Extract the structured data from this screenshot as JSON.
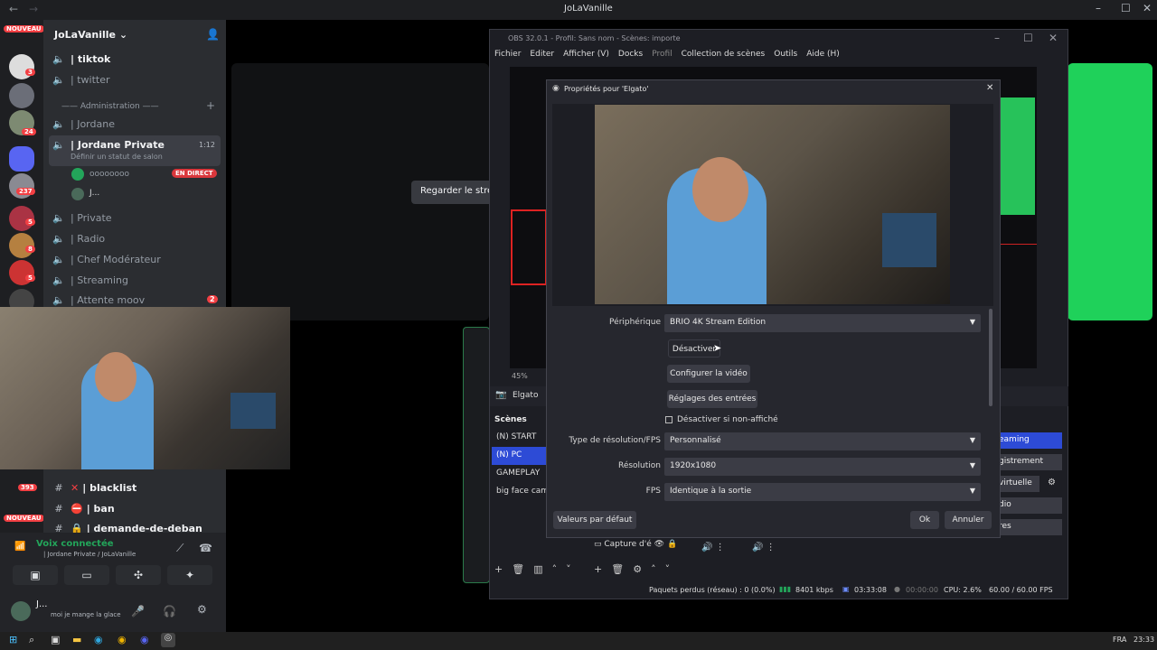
{
  "discord": {
    "window_title": "JoLaVanille",
    "server_name": "JoLaVanille",
    "guild_badges": [
      "NOUVEAU",
      "3",
      "24",
      "237",
      "5",
      "8",
      "5",
      "3",
      "393",
      "NOUVEAU"
    ],
    "channels": [
      {
        "icon": "speaker-icon",
        "name": "| tiktok",
        "bold": true
      },
      {
        "icon": "speaker-icon",
        "name": "| twitter",
        "bold": false
      },
      {
        "icon": "speaker-icon",
        "name": "| Jordane",
        "bold": false
      },
      {
        "icon": "speaker-icon",
        "name": "| Jordane Private",
        "bold": true,
        "time": "1:12"
      },
      {
        "icon": "speaker-icon",
        "name": "| Private",
        "bold": false
      },
      {
        "icon": "speaker-icon",
        "name": "| Radio",
        "bold": false
      },
      {
        "icon": "speaker-icon",
        "name": "| Chef Modérateur",
        "bold": false
      },
      {
        "icon": "speaker-icon",
        "name": "| Streaming",
        "bold": false
      },
      {
        "icon": "speaker-icon",
        "name": "| Attente moov",
        "bold": false,
        "badge": "2"
      }
    ],
    "category": "—— Administration ——",
    "status_hint": "Définir un statut de salon",
    "members": [
      {
        "name": "oooooooo",
        "live": "EN DIRECT"
      },
      {
        "name": "J..."
      }
    ],
    "watch_button": "Regarder le strea",
    "text_channels": [
      "| blacklist",
      "| ban",
      "| demande-de-deban"
    ],
    "voice": {
      "status": "Voix connectée",
      "channel": "| Jordane Private / JoLaVanille"
    },
    "user": {
      "name": "J...",
      "status": "moi je mange la glace"
    }
  },
  "obs": {
    "title": "OBS 32.0.1 - Profil: Sans nom - Scènes: importe",
    "menu": [
      "Fichier",
      "Editer",
      "Afficher (V)",
      "Docks",
      "Profil",
      "Collection de scènes",
      "Outils",
      "Aide (H)"
    ],
    "zoom": "45%",
    "source_label": "Elgato",
    "scenes_header": "Scènes",
    "scenes": [
      "(N) START",
      "(N) PC",
      "GAMEPLAY",
      "big face cam"
    ],
    "source_item": "Capture d'é",
    "controls": [
      "eaming",
      "gistrement",
      "virtuelle",
      "dio",
      "res"
    ],
    "status": {
      "dropped": "Paquets perdus (réseau) : 0 (0.0%)",
      "bitrate": "8401 kbps",
      "rec_time": "03:33:08",
      "stream_time": "00:00:00",
      "cpu": "CPU: 2.6%",
      "fps": "60.00 / 60.00 FPS"
    }
  },
  "dialog": {
    "title": "Propriétés pour 'Elgato'",
    "device_label": "Périphérique",
    "device_value": "BRIO 4K Stream Edition",
    "deactivate": "Désactiver",
    "configure_video": "Configurer la vidéo",
    "input_settings": "Réglages des entrées",
    "hide_checkbox": "Désactiver si non-affiché",
    "res_type_label": "Type de résolution/FPS",
    "res_type_value": "Personnalisé",
    "resolution_label": "Résolution",
    "resolution_value": "1920x1080",
    "fps_label": "FPS",
    "fps_value": "Identique à la sortie",
    "defaults": "Valeurs par défaut",
    "ok": "Ok",
    "cancel": "Annuler"
  },
  "taskbar": {
    "lang": "FRA",
    "time": "23:33"
  },
  "colors": {
    "obs_accent": "#2d4bd6",
    "green": "#23a55a",
    "discord_red": "#f23f43"
  }
}
